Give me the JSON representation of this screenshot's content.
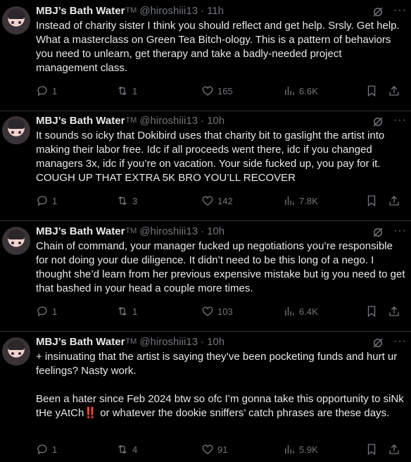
{
  "tweets": [
    {
      "name": "MBJ’s Bath Water",
      "tm": "TM",
      "handle": "@hiroshiii13",
      "sep": "·",
      "time": "11h",
      "text": "Instead of charity sister I think you should reflect and get help. Srsly. Get help. What a masterclass on Green Tea Bitch-ology. This is a pattern of behaviors you need to unlearn, get therapy and take a badly-needed project management class.",
      "replies": "1",
      "reposts": "1",
      "likes": "165",
      "views": "6.6K"
    },
    {
      "name": "MBJ’s Bath Water",
      "tm": "TM",
      "handle": "@hiroshiii13",
      "sep": "·",
      "time": "10h",
      "text": "It sounds so icky that Dokibird uses that charity bit to gaslight the artist into making their labor free. Idc if all proceeds went there, idc if you changed managers 3x, idc if you’re on vacation. Your side fucked up, you pay for it. COUGH UP THAT EXTRA 5K BRO YOU’LL RECOVER",
      "replies": "1",
      "reposts": "3",
      "likes": "142",
      "views": "7.8K"
    },
    {
      "name": "MBJ’s Bath Water",
      "tm": "TM",
      "handle": "@hiroshiii13",
      "sep": "·",
      "time": "10h",
      "text": "Chain of command, your manager fucked up negotiations you’re responsible for not doing your due diligence. It didn’t need to be this long of a nego. I thought she’d learn from her previous expensive mistake but ig you need to get that bashed in your head a couple more times.",
      "replies": "1",
      "reposts": "1",
      "likes": "103",
      "views": "6.4K"
    },
    {
      "name": "MBJ’s Bath Water",
      "tm": "TM",
      "handle": "@hiroshiii13",
      "sep": "·",
      "time": "10h",
      "text": "+ insinuating that the artist is saying they’ve been pocketing funds and hurt ur feelings? Nasty work.\n\nBeen a hater since Feb 2024 btw so ofc I’m gonna take this opportunity to siNk tHe yAtCh‼️ or whatever the dookie sniffers’ catch phrases are these days.",
      "replies": "1",
      "reposts": "4",
      "likes": "91",
      "views": "5.9K"
    }
  ],
  "icons": {
    "reply": "reply-icon",
    "repost": "repost-icon",
    "like": "heart-icon",
    "views": "views-icon",
    "bookmark": "bookmark-icon",
    "share": "share-icon",
    "grok": "grok-icon",
    "more": "more-icon"
  },
  "colors": {
    "background": "#000000",
    "text": "#e7e9ea",
    "muted": "#71767b",
    "border": "#2f3336"
  }
}
